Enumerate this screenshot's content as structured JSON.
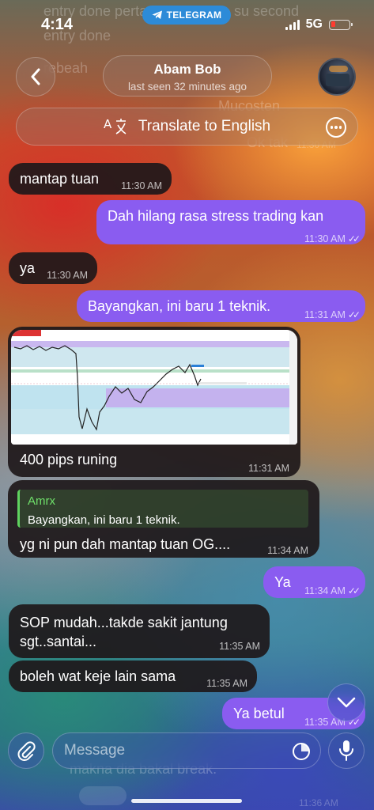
{
  "status_bar": {
    "time": "4:14",
    "app_pill": "TELEGRAM",
    "network": "5G"
  },
  "header": {
    "chat_name": "Abam Bob",
    "last_seen": "last seen 32 minutes ago"
  },
  "translate_bar": {
    "label": "Translate to English"
  },
  "background_ghost_text": {
    "top1": "entry done perta",
    "top2": "su second",
    "top3": "entry done",
    "top4": "rebeah",
    "mid1": "Mucosten",
    "mid2": "Ok tak",
    "mid2_time": "11:30 AM",
    "bottom1": "makna dia bakal break.",
    "bottom2_time": "11:36 AM"
  },
  "messages": [
    {
      "id": "m1",
      "direction": "in",
      "text": "mantap tuan",
      "time": "11:30 AM"
    },
    {
      "id": "m2",
      "direction": "out",
      "text": "Dah hilang rasa stress trading kan",
      "time": "11:30 AM"
    },
    {
      "id": "m3",
      "direction": "in",
      "text": "ya",
      "time": "11:30 AM"
    },
    {
      "id": "m4",
      "direction": "out",
      "text": "Bayangkan, ini baru 1 teknik.",
      "time": "11:31 AM"
    },
    {
      "id": "m5",
      "direction": "in",
      "text": "400 pips runing",
      "time": "11:31 AM",
      "has_image": true
    },
    {
      "id": "m6",
      "direction": "in",
      "text": "yg ni pun dah mantap tuan OG....",
      "time": "11:34 AM",
      "reply_to": {
        "name": "Amrx",
        "text": "Bayangkan, ini baru 1 teknik."
      }
    },
    {
      "id": "m7",
      "direction": "out",
      "text": "Ya",
      "time": "11:34 AM"
    },
    {
      "id": "m8",
      "direction": "in",
      "text_line1": "SOP mudah...takde sakit jantung",
      "text_line2": "sgt..santai...",
      "time": "11:35 AM"
    },
    {
      "id": "m9",
      "direction": "in",
      "text": "boleh wat keje lain sama",
      "time": "11:35 AM"
    },
    {
      "id": "m10",
      "direction": "out",
      "text": "Ya betul",
      "time": "11:35 AM"
    }
  ],
  "composer": {
    "placeholder": "Message"
  },
  "icons": {
    "back": "chevron-left-icon",
    "translate": "translate-icon",
    "more": "more-horizontal-icon",
    "attach": "paperclip-icon",
    "sticker": "sticker-icon",
    "mic": "microphone-icon",
    "scroll_down": "chevron-down-icon",
    "read_receipt": "double-check-icon"
  },
  "colors": {
    "outgoing_bubble": "#8a5cf0",
    "incoming_bubble": "#1e181a",
    "reply_accent": "#5fd35f",
    "telegram_pill": "#2d8bd8"
  }
}
